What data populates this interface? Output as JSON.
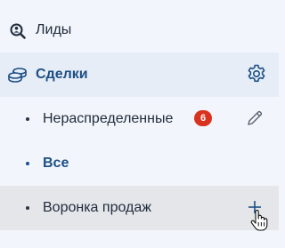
{
  "nav": {
    "leads": {
      "label": "Лиды",
      "icon": "search-person-icon"
    },
    "deals": {
      "label": "Сделки",
      "icon": "coins-icon",
      "settings_icon": "gear-icon",
      "subitems": [
        {
          "label": "Нераспределенные",
          "badge": "6",
          "action_icon": "pencil-icon"
        },
        {
          "label": "Все",
          "selected": true
        },
        {
          "label": "Воронка продаж",
          "action_icon": "plus-icon"
        }
      ]
    }
  },
  "colors": {
    "accent": "#1d4f86",
    "badge": "#d9331f",
    "background": "#f2f5fb",
    "active_row": "#e6edf7",
    "hover_row": "#e4e6ea"
  }
}
